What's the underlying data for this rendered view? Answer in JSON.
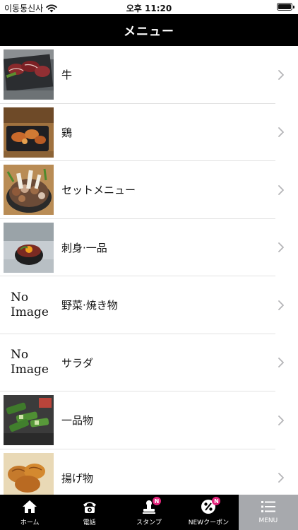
{
  "status_bar": {
    "carrier": "이동통신사",
    "time": "오후 11:20"
  },
  "header": {
    "title": "メニュー"
  },
  "menu": {
    "items": [
      {
        "label": "牛",
        "image": "photo"
      },
      {
        "label": "鶏",
        "image": "photo"
      },
      {
        "label": "セットメニュー",
        "image": "photo"
      },
      {
        "label": "刺身·一品",
        "image": "photo"
      },
      {
        "label": "野菜·焼き物",
        "image": "none",
        "no_image_line1": "No",
        "no_image_line2": "Image"
      },
      {
        "label": "サラダ",
        "image": "none",
        "no_image_line1": "No",
        "no_image_line2": "Image"
      },
      {
        "label": "一品物",
        "image": "photo"
      },
      {
        "label": "揚げ物",
        "image": "photo"
      }
    ]
  },
  "tab_bar": {
    "tabs": [
      {
        "label": "ホーム",
        "icon": "home-icon"
      },
      {
        "label": "電話",
        "icon": "phone-icon"
      },
      {
        "label": "スタンプ",
        "icon": "stamp-icon",
        "badge": "N"
      },
      {
        "label": "NEWクーポン",
        "icon": "coupon-icon",
        "badge": "N"
      },
      {
        "label": "MENU",
        "icon": "menu-list-icon",
        "active": true
      }
    ]
  },
  "colors": {
    "header_bg": "#000000",
    "tab_bar_bg": "#000000",
    "active_tab_bg": "#a7a9ad",
    "badge": "#e3257c"
  }
}
